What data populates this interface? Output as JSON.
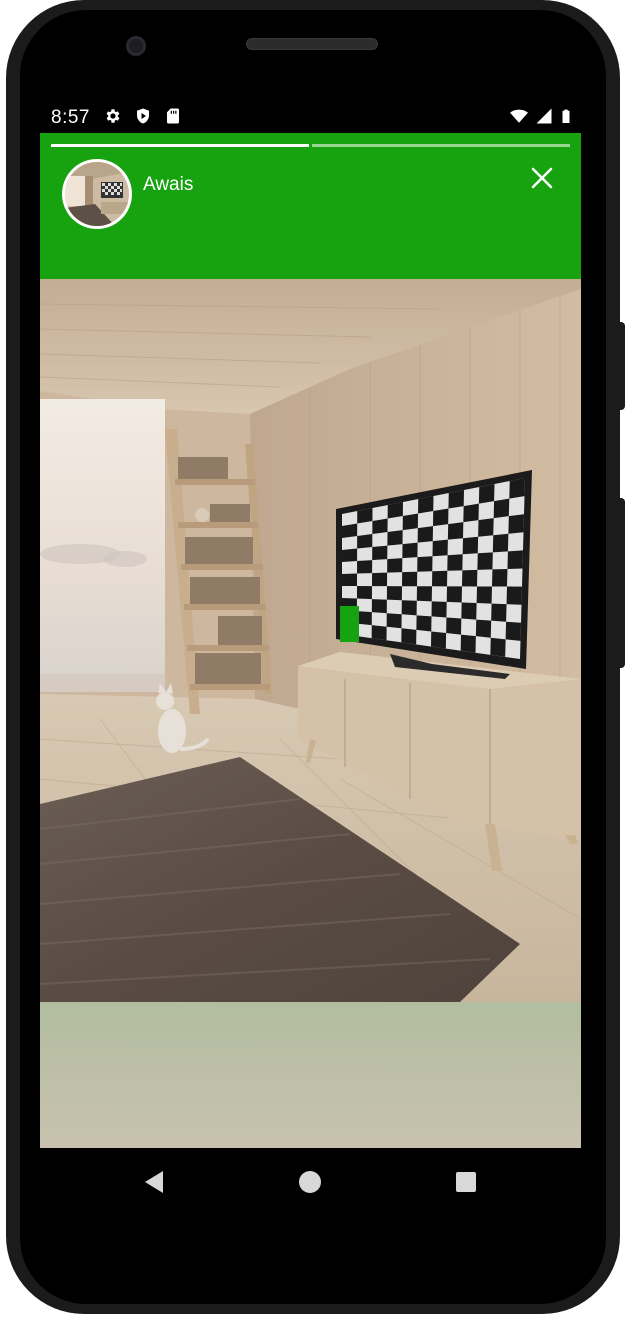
{
  "status_bar": {
    "time": "8:57",
    "left_icons": [
      "gear-icon",
      "shield-play-icon",
      "sd-card-icon"
    ],
    "right_icons": [
      "wifi-icon",
      "signal-icon",
      "battery-icon"
    ]
  },
  "story": {
    "segments": [
      {
        "progress": 1.0
      },
      {
        "progress": 0.0
      }
    ],
    "user": {
      "name": "Awais",
      "avatar": "room-thumbnail"
    },
    "close_icon": "close-icon",
    "image": "living-room-tv-checkerboard",
    "header_color": "#17a20f"
  },
  "navigation": {
    "back_icon": "back-icon",
    "home_icon": "home-icon",
    "recents_icon": "recents-icon"
  }
}
